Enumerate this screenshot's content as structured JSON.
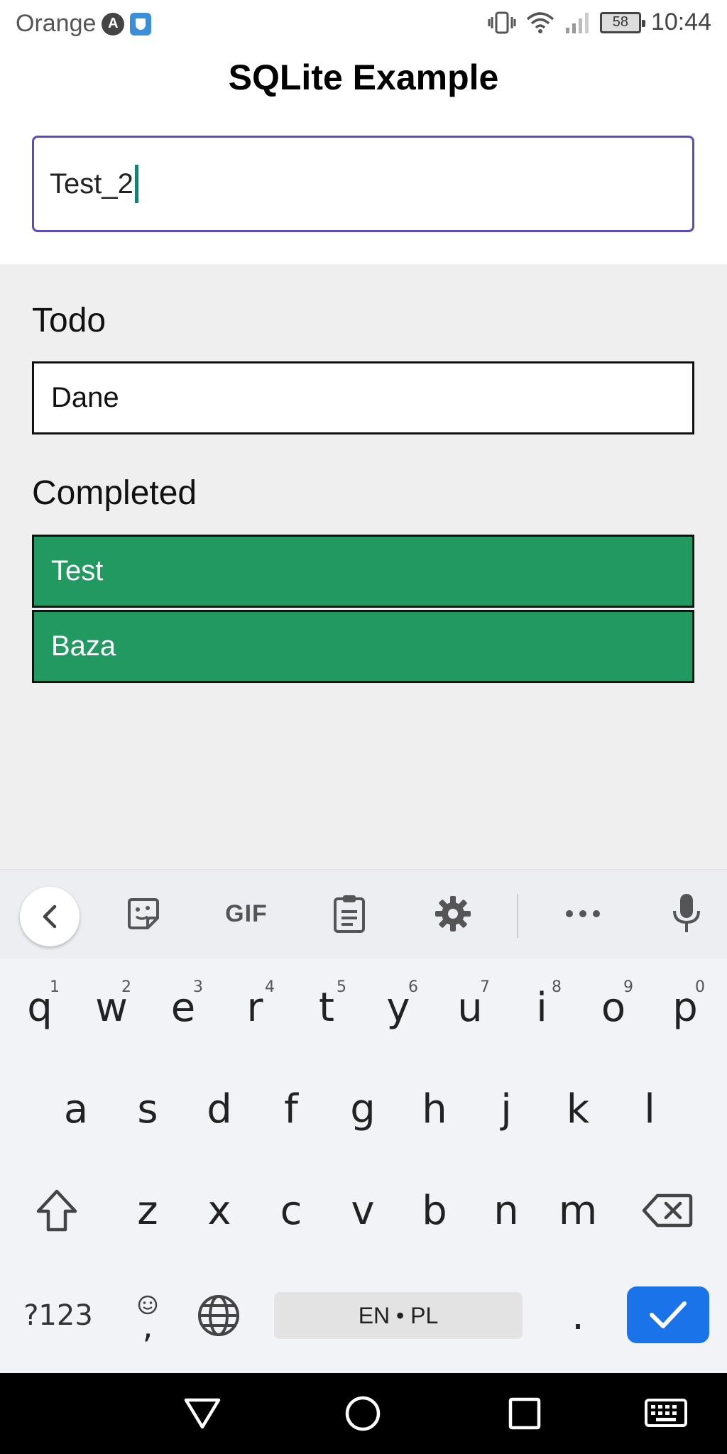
{
  "status_bar": {
    "carrier": "Orange",
    "battery": "58",
    "time": "10:44"
  },
  "app": {
    "title": "SQLite Example",
    "input_value": "Test_2"
  },
  "todo": {
    "title": "Todo",
    "items": [
      "Dane"
    ]
  },
  "completed": {
    "title": "Completed",
    "items": [
      "Test",
      "Baza"
    ]
  },
  "keyboard": {
    "toolbar": {
      "gif_label": "GIF"
    },
    "row1": [
      {
        "key": "q",
        "hint": "1"
      },
      {
        "key": "w",
        "hint": "2"
      },
      {
        "key": "e",
        "hint": "3"
      },
      {
        "key": "r",
        "hint": "4"
      },
      {
        "key": "t",
        "hint": "5"
      },
      {
        "key": "y",
        "hint": "6"
      },
      {
        "key": "u",
        "hint": "7"
      },
      {
        "key": "i",
        "hint": "8"
      },
      {
        "key": "o",
        "hint": "9"
      },
      {
        "key": "p",
        "hint": "0"
      }
    ],
    "row2": [
      "a",
      "s",
      "d",
      "f",
      "g",
      "h",
      "j",
      "k",
      "l"
    ],
    "row3": [
      "z",
      "x",
      "c",
      "v",
      "b",
      "n",
      "m"
    ],
    "symbols_label": "?123",
    "emoji_comma": ",",
    "space_label": "EN • PL",
    "period": "."
  },
  "colors": {
    "accent_input_border": "#5b4dbd",
    "completed_bg": "#229960",
    "enter_key": "#1a73e8"
  }
}
